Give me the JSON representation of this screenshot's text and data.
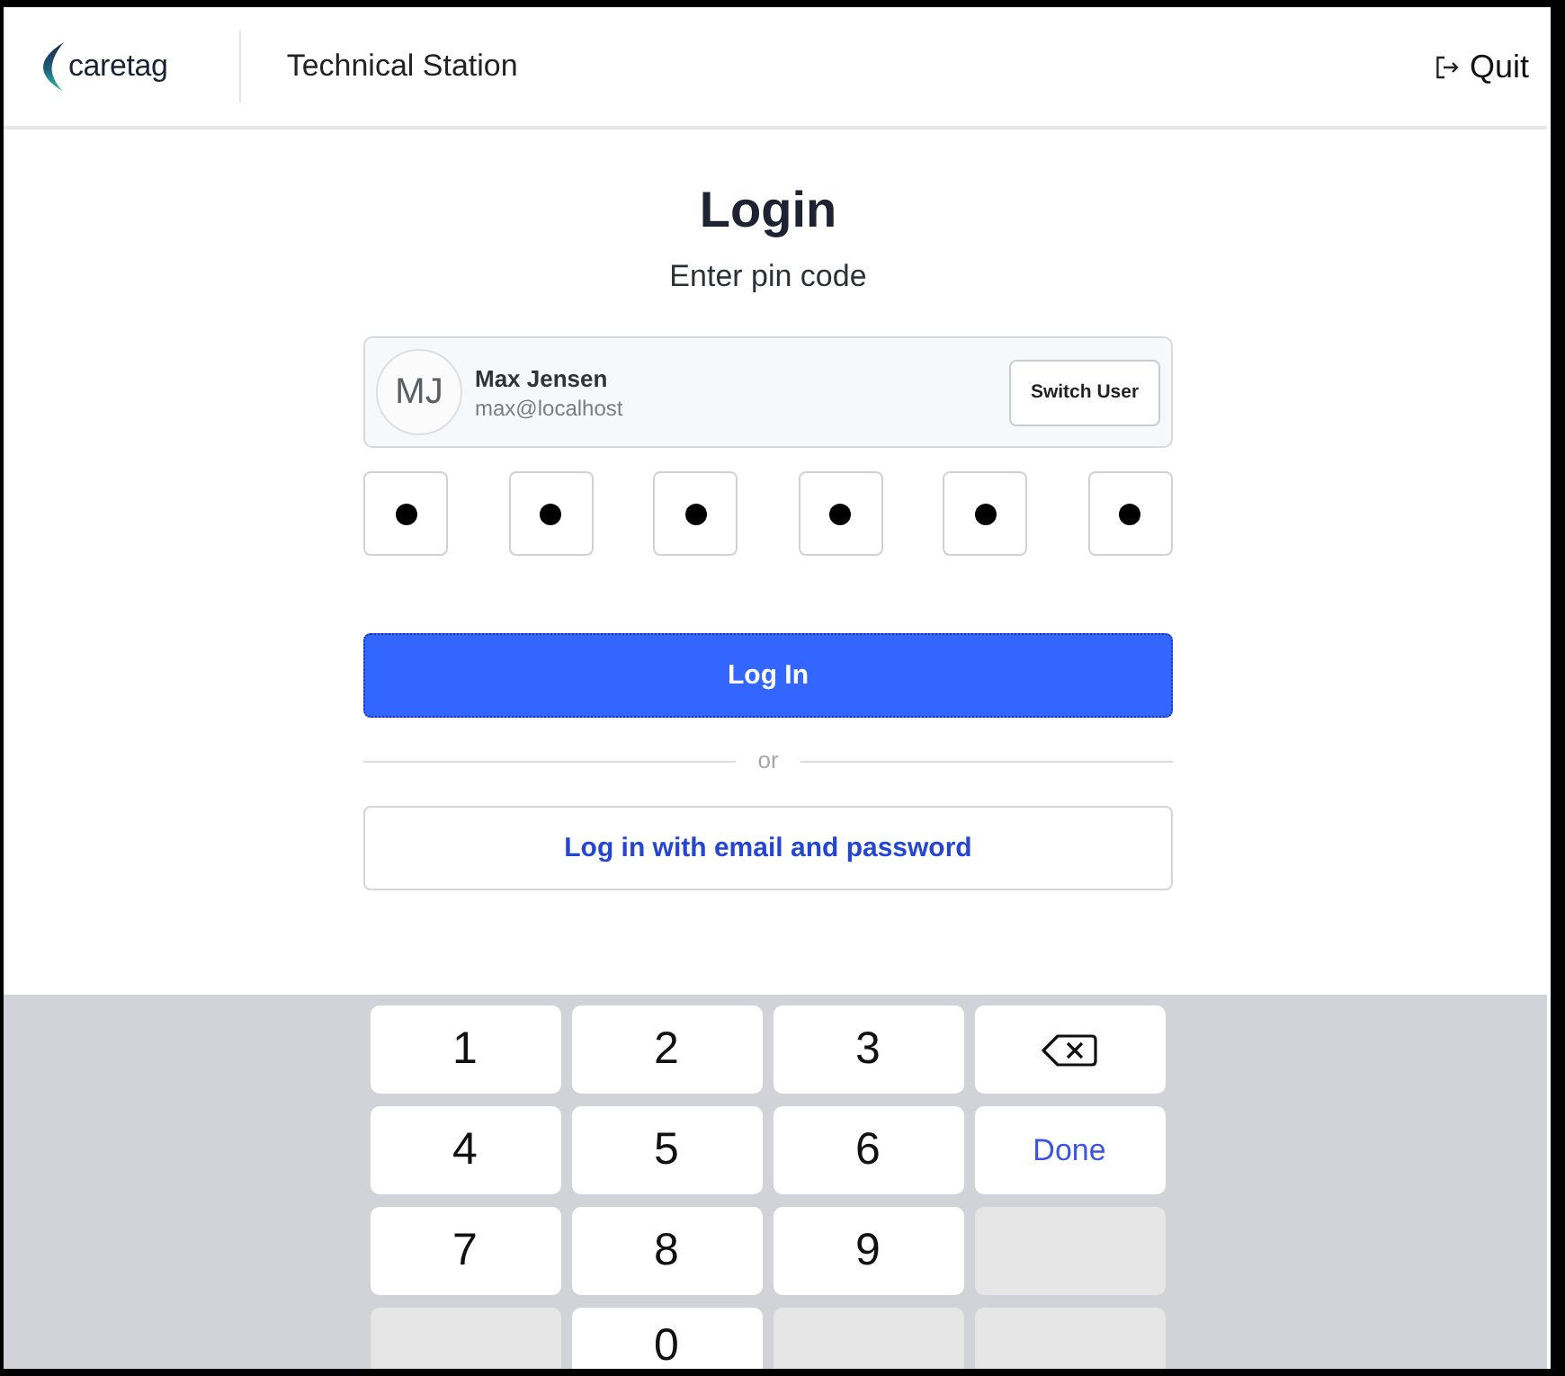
{
  "header": {
    "logo_text": "caretag",
    "title": "Technical Station",
    "quit_label": "Quit"
  },
  "login": {
    "title": "Login",
    "subtitle": "Enter pin code",
    "user": {
      "initials": "MJ",
      "name": "Max Jensen",
      "email": "max@localhost",
      "switch_label": "Switch User"
    },
    "pin_digits": [
      {
        "filled": true
      },
      {
        "filled": true
      },
      {
        "filled": true
      },
      {
        "filled": true
      },
      {
        "filled": true
      },
      {
        "filled": true
      }
    ],
    "primary_button": "Log In",
    "divider_text": "or",
    "secondary_button": "Log in with email and password"
  },
  "keypad": {
    "rows": [
      [
        {
          "kind": "digit",
          "label": "1"
        },
        {
          "kind": "digit",
          "label": "2"
        },
        {
          "kind": "digit",
          "label": "3"
        },
        {
          "kind": "backspace"
        }
      ],
      [
        {
          "kind": "digit",
          "label": "4"
        },
        {
          "kind": "digit",
          "label": "5"
        },
        {
          "kind": "digit",
          "label": "6"
        },
        {
          "kind": "done",
          "label": "Done"
        }
      ],
      [
        {
          "kind": "digit",
          "label": "7"
        },
        {
          "kind": "digit",
          "label": "8"
        },
        {
          "kind": "digit",
          "label": "9"
        },
        {
          "kind": "blank"
        }
      ],
      [
        {
          "kind": "blank"
        },
        {
          "kind": "digit",
          "label": "0"
        },
        {
          "kind": "blank"
        },
        {
          "kind": "blank"
        }
      ]
    ]
  }
}
